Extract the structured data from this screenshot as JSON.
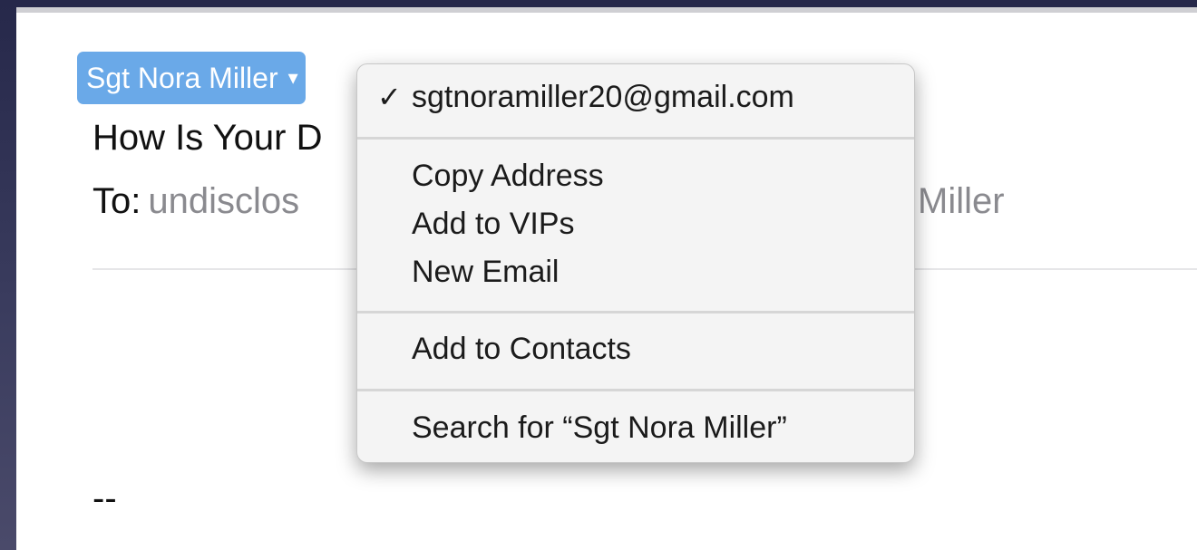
{
  "message": {
    "sender_name": "Sgt Nora Miller",
    "subject_partial": "How Is Your D",
    "to_label": "To:",
    "to_value_partial": "undisclos",
    "to_value_tail": "Miller",
    "signature": "--"
  },
  "context_menu": {
    "selected_email": "sgtnoramiller20@gmail.com",
    "check_mark": "✓",
    "items": [
      {
        "label": "Copy Address"
      },
      {
        "label": "Add to VIPs"
      },
      {
        "label": "New Email"
      },
      {
        "label": "Add to Contacts"
      },
      {
        "label": "Search for “Sgt Nora Miller”"
      }
    ]
  },
  "icons": {
    "sender_dropdown": "chevron-down-icon",
    "selected_mark": "checkmark-icon"
  },
  "colors": {
    "sender_token": "#6aa9e8",
    "menu_background": "#f4f4f4"
  }
}
